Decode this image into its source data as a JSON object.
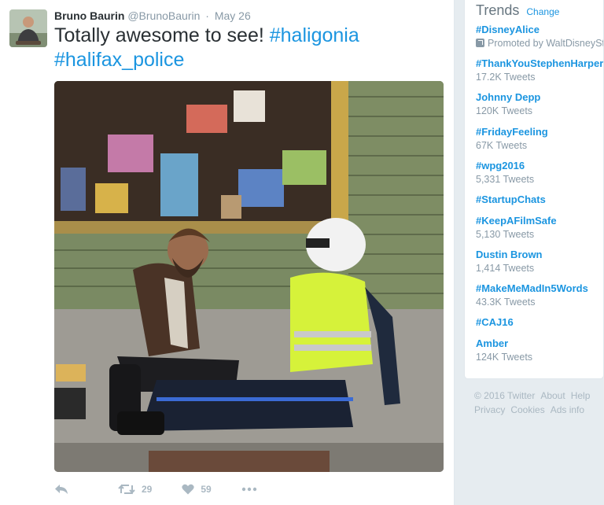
{
  "tweet": {
    "fullname": "Bruno Baurin",
    "handle": "@BrunoBaurin",
    "separator": "·",
    "date": "May 26",
    "text_prefix": "Totally awesome to see! ",
    "hashtag_1": "#haligonia",
    "hashtag_2": "#halifax_police",
    "retweet_count": "29",
    "like_count": "59"
  },
  "trends": {
    "title": "Trends",
    "change": "Change",
    "items": [
      {
        "name": "#DisneyAlice",
        "meta": "Promoted by WaltDisneyStudios"
      },
      {
        "name": "#ThankYouStephenHarper",
        "meta": "17.2K Tweets"
      },
      {
        "name": "Johnny Depp",
        "meta": "120K Tweets"
      },
      {
        "name": "#FridayFeeling",
        "meta": "67K Tweets"
      },
      {
        "name": "#wpg2016",
        "meta": "5,331 Tweets"
      },
      {
        "name": "#StartupChats",
        "meta": ""
      },
      {
        "name": "#KeepAFilmSafe",
        "meta": "5,130 Tweets"
      },
      {
        "name": "Dustin Brown",
        "meta": "1,414 Tweets"
      },
      {
        "name": "#MakeMeMadIn5Words",
        "meta": "43.3K Tweets"
      },
      {
        "name": "#CAJ16",
        "meta": ""
      },
      {
        "name": "Amber",
        "meta": "124K Tweets"
      }
    ]
  },
  "footer": {
    "copyright": "© 2016 Twitter",
    "about": "About",
    "help": "Help",
    "privacy": "Privacy",
    "cookies": "Cookies",
    "ads_info": "Ads info"
  },
  "colors": {
    "link_blue": "#1b95e0",
    "text_dark": "#292f33",
    "text_grey": "#8899a6",
    "icon_grey": "#aab8c2",
    "background": "#e6ecf0"
  },
  "icons": {
    "reply": "reply-icon",
    "retweet": "retweet-icon",
    "like": "heart-icon",
    "more": "more-icon",
    "promoted": "promoted-icon"
  }
}
